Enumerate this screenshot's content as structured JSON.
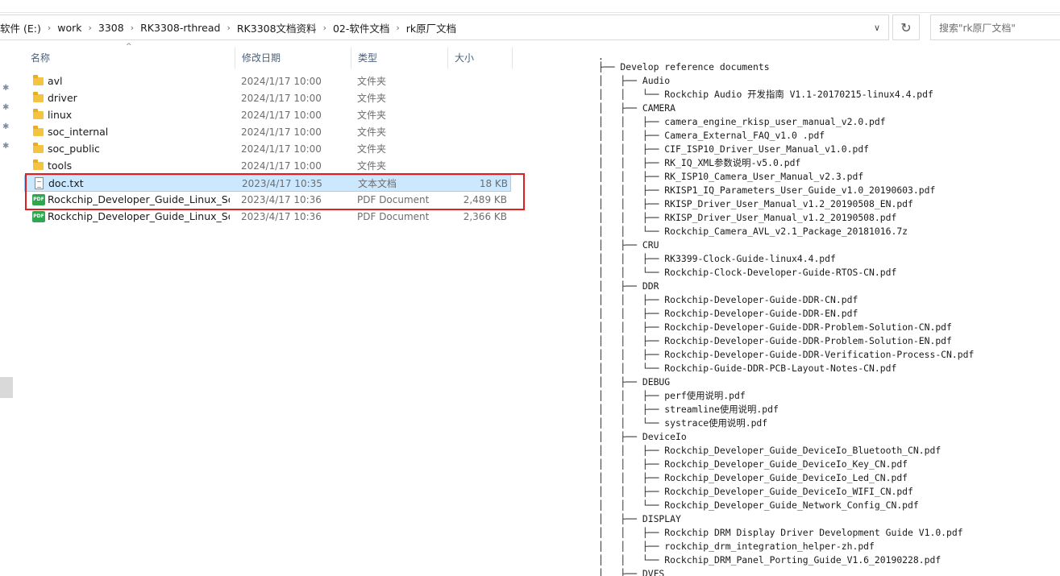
{
  "breadcrumb": [
    "软件 (E:)",
    "work",
    "3308",
    "RK3308-rthread",
    "RK3308文档资料",
    "02-软件文档",
    "rk原厂文档"
  ],
  "search": {
    "placeholder": "搜索\"rk原厂文档\""
  },
  "columns": {
    "name": "名称",
    "date": "修改日期",
    "type": "类型",
    "size": "大小"
  },
  "files": [
    {
      "name": "avl",
      "date": "2024/1/17 10:00",
      "type": "文件夹",
      "size": "",
      "icon": "folder-icon"
    },
    {
      "name": "driver",
      "date": "2024/1/17 10:00",
      "type": "文件夹",
      "size": "",
      "icon": "folder-icon"
    },
    {
      "name": "linux",
      "date": "2024/1/17 10:00",
      "type": "文件夹",
      "size": "",
      "icon": "folder-icon"
    },
    {
      "name": "soc_internal",
      "date": "2024/1/17 10:00",
      "type": "文件夹",
      "size": "",
      "icon": "folder-icon"
    },
    {
      "name": "soc_public",
      "date": "2024/1/17 10:00",
      "type": "文件夹",
      "size": "",
      "icon": "folder-icon"
    },
    {
      "name": "tools",
      "date": "2024/1/17 10:00",
      "type": "文件夹",
      "size": "",
      "icon": "folder-icon"
    },
    {
      "name": "doc.txt",
      "date": "2023/4/17 10:35",
      "type": "文本文档",
      "size": "18 KB",
      "icon": "text-file-icon",
      "selected": true
    },
    {
      "name": "Rockchip_Developer_Guide_Linux_Sof...",
      "date": "2023/4/17 10:36",
      "type": "PDF Document",
      "size": "2,489 KB",
      "icon": "pdf-file-icon"
    },
    {
      "name": "Rockchip_Developer_Guide_Linux_Sof...",
      "date": "2023/4/17 10:36",
      "type": "PDF Document",
      "size": "2,366 KB",
      "icon": "pdf-file-icon"
    }
  ],
  "preview_lines": [
    ".",
    "├── Develop reference documents",
    "│   ├── Audio",
    "│   │   └── Rockchip Audio 开发指南 V1.1-20170215-linux4.4.pdf",
    "│   ├── CAMERA",
    "│   │   ├── camera_engine_rkisp_user_manual_v2.0.pdf",
    "│   │   ├── Camera_External_FAQ_v1.0 .pdf",
    "│   │   ├── CIF_ISP10_Driver_User_Manual_v1.0.pdf",
    "│   │   ├── RK_IQ_XML参数说明-v5.0.pdf",
    "│   │   ├── RK_ISP10_Camera_User_Manual_v2.3.pdf",
    "│   │   ├── RKISP1_IQ_Parameters_User_Guide_v1.0_20190603.pdf",
    "│   │   ├── RKISP_Driver_User_Manual_v1.2_20190508_EN.pdf",
    "│   │   ├── RKISP_Driver_User_Manual_v1.2_20190508.pdf",
    "│   │   └── Rockchip_Camera_AVL_v2.1_Package_20181016.7z",
    "│   ├── CRU",
    "│   │   ├── RK3399-Clock-Guide-linux4.4.pdf",
    "│   │   └── Rockchip-Clock-Developer-Guide-RTOS-CN.pdf",
    "│   ├── DDR",
    "│   │   ├── Rockchip-Developer-Guide-DDR-CN.pdf",
    "│   │   ├── Rockchip-Developer-Guide-DDR-EN.pdf",
    "│   │   ├── Rockchip-Developer-Guide-DDR-Problem-Solution-CN.pdf",
    "│   │   ├── Rockchip-Developer-Guide-DDR-Problem-Solution-EN.pdf",
    "│   │   ├── Rockchip-Developer-Guide-DDR-Verification-Process-CN.pdf",
    "│   │   └── Rockchip-Guide-DDR-PCB-Layout-Notes-CN.pdf",
    "│   ├── DEBUG",
    "│   │   ├── perf使用说明.pdf",
    "│   │   ├── streamline使用说明.pdf",
    "│   │   └── systrace使用说明.pdf",
    "│   ├── DeviceIo",
    "│   │   ├── Rockchip_Developer_Guide_DeviceIo_Bluetooth_CN.pdf",
    "│   │   ├── Rockchip_Developer_Guide_DeviceIo_Key_CN.pdf",
    "│   │   ├── Rockchip_Developer_Guide_DeviceIo_Led_CN.pdf",
    "│   │   ├── Rockchip_Developer_Guide_DeviceIo_WIFI_CN.pdf",
    "│   │   └── Rockchip_Developer_Guide_Network_Config_CN.pdf",
    "│   ├── DISPLAY",
    "│   │   ├── Rockchip DRM Display Driver Development Guide V1.0.pdf",
    "│   │   ├── rockchip_drm_integration_helper-zh.pdf",
    "│   │   └── Rockchip_DRM_Panel_Porting_Guide_V1.6_20190228.pdf",
    "│   ├── DVFS"
  ]
}
